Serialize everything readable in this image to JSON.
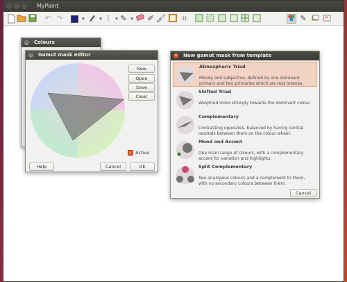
{
  "app": {
    "title": "MyPaint",
    "window_controls": [
      "close",
      "minimize",
      "maximize"
    ]
  },
  "toolbar": {
    "icons": [
      "new-file-icon",
      "open-file-icon",
      "save-file-icon",
      "undo-icon",
      "redo-icon",
      "color-swatch-icon",
      "brush-dropdown-icon",
      "line-mode-icon",
      "symmetry-icon",
      "eraser-icon",
      "pencil-icon",
      "brush-icon",
      "blur-icon",
      "frame-icon",
      "zoom-fit-icon",
      "select-icon",
      "ruler-icon",
      "crop-icon",
      "hatch-icon",
      "color-panel-icon",
      "brush-panel-icon",
      "layers-icon",
      "scratchpad-icon"
    ],
    "accent": "#1a237e"
  },
  "colours_window": {
    "title": "Colours"
  },
  "gamut_editor": {
    "title": "Gamut mask editor",
    "buttons": {
      "new": "New",
      "open": "Open",
      "save": "Save",
      "clear": "Clear",
      "help": "Help",
      "cancel": "Cancel",
      "ok": "OK"
    },
    "active_label": "Active",
    "active_checked": true
  },
  "template_dialog": {
    "title": "New gamut mask from template",
    "templates": [
      {
        "name": "Atmospheric Triad",
        "description": "Moody and subjective, defined by one dominant primary and two primaries which are less intense.",
        "selected": true
      },
      {
        "name": "Shifted Triad",
        "description": "Weighted more strongly towards the dominant colour.",
        "selected": false
      },
      {
        "name": "Complementary",
        "description": "Contrasting opposites, balanced by having central neutrals between them on the colour wheel.",
        "selected": false
      },
      {
        "name": "Mood and Accent",
        "description": "One main range of colours, with a complementary accent for variation and highlights.",
        "selected": false
      },
      {
        "name": "Split Complementary",
        "description": "Two analogous colours and a complement to them, with no secondary colours between them.",
        "selected": false
      }
    ],
    "cancel_label": "Cancel"
  },
  "colors": {
    "selected_bg": "#f3d3c4",
    "window_bg": "#f2f1f0",
    "titlebar": "#3c3b37",
    "close_active": "#e95420"
  }
}
